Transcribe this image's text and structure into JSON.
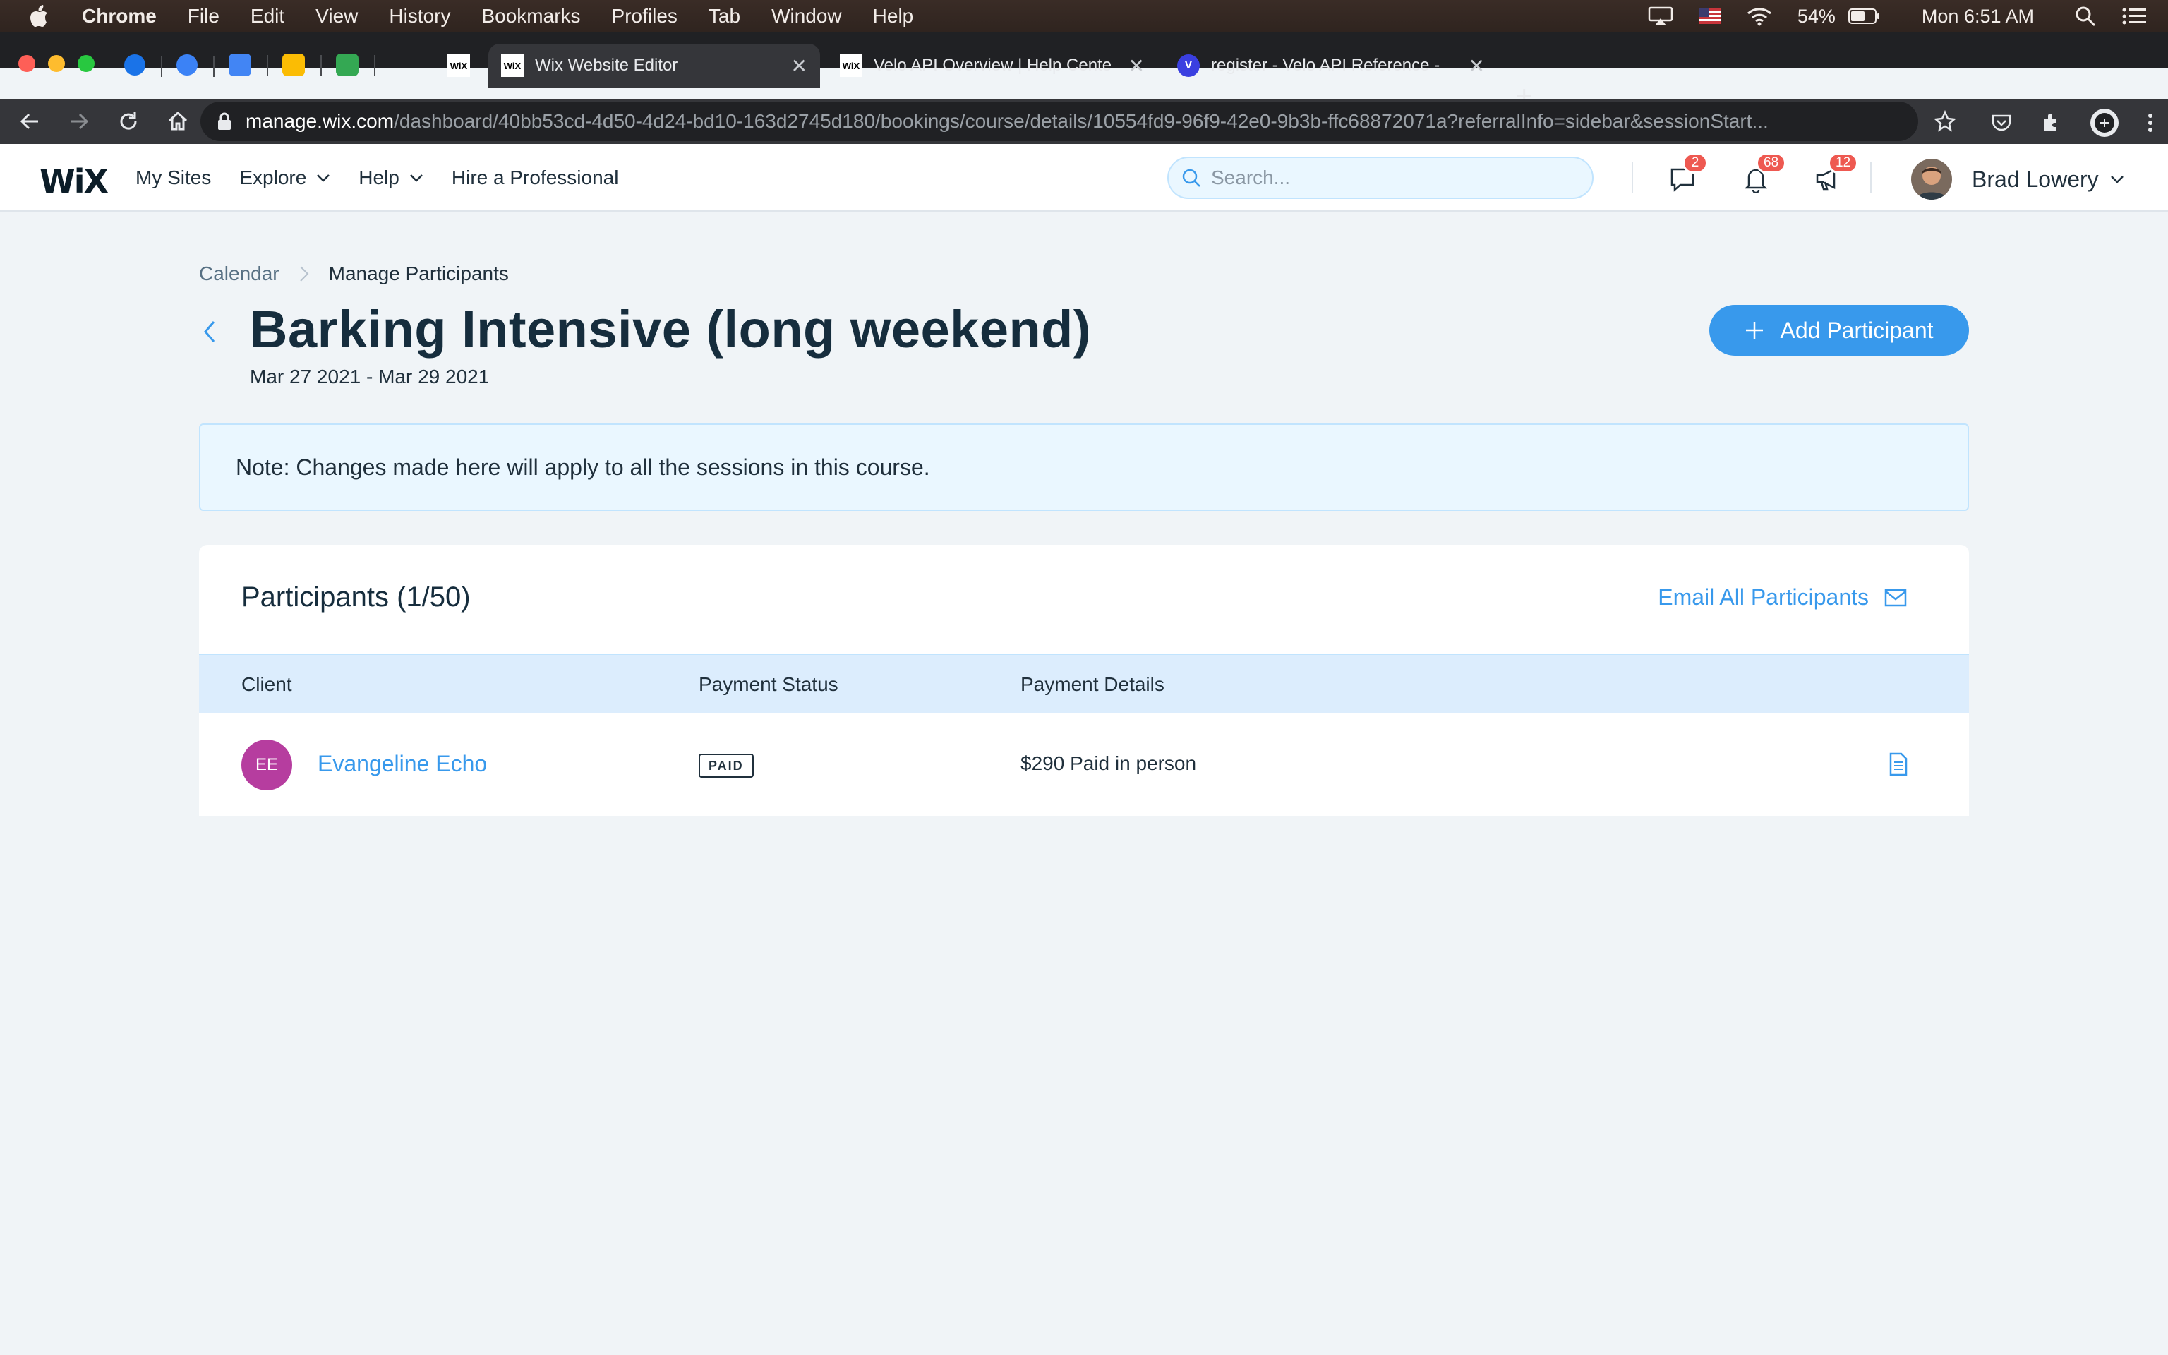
{
  "menubar": {
    "app_name": "Chrome",
    "items": [
      "File",
      "Edit",
      "View",
      "History",
      "Bookmarks",
      "Profiles",
      "Tab",
      "Window",
      "Help"
    ],
    "battery": "54%",
    "clock": "Mon 6:51 AM"
  },
  "tabs": [
    {
      "title": "Wix Website Editor",
      "favicon": "WiX",
      "active": true
    },
    {
      "title": "Velo API Overview | Help Cente",
      "favicon": "WiX",
      "active": false
    },
    {
      "title": "register - Velo API Reference -",
      "favicon": "V",
      "active": false
    }
  ],
  "omnibox": {
    "host": "manage.wix.com",
    "path": "/dashboard/40bb53cd-4d50-4d24-bd10-163d2745d180/bookings/course/details/10554fd9-96f9-42e0-9b3b-ffc68872071a?referralInfo=sidebar&sessionStart..."
  },
  "wix": {
    "logo": "WiX",
    "nav": {
      "my_sites": "My Sites",
      "explore": "Explore",
      "help": "Help",
      "hire": "Hire a Professional"
    },
    "search_placeholder": "Search...",
    "badges": {
      "messages": "2",
      "notifications": "68",
      "announcements": "12"
    },
    "user_name": "Brad Lowery"
  },
  "page": {
    "breadcrumb": {
      "root": "Calendar",
      "current": "Manage Participants"
    },
    "title": "Barking Intensive (long weekend)",
    "dates": "Mar 27 2021 - Mar 29 2021",
    "add_button": "Add Participant",
    "note": "Note: Changes made here will apply to all the sessions in this course."
  },
  "participants": {
    "title": "Participants (1/50)",
    "email_all": "Email All Participants",
    "columns": [
      "Client",
      "Payment Status",
      "Payment Details"
    ],
    "rows": [
      {
        "initials": "EE",
        "name": "Evangeline Echo",
        "status": "PAID",
        "details": "$290 Paid in person"
      }
    ]
  },
  "colors": {
    "accent": "#3899ec",
    "note_bg": "#eaf7ff",
    "table_header_bg": "#dcedfd",
    "avatar": "#b63d9f",
    "badge": "#ee5951"
  }
}
